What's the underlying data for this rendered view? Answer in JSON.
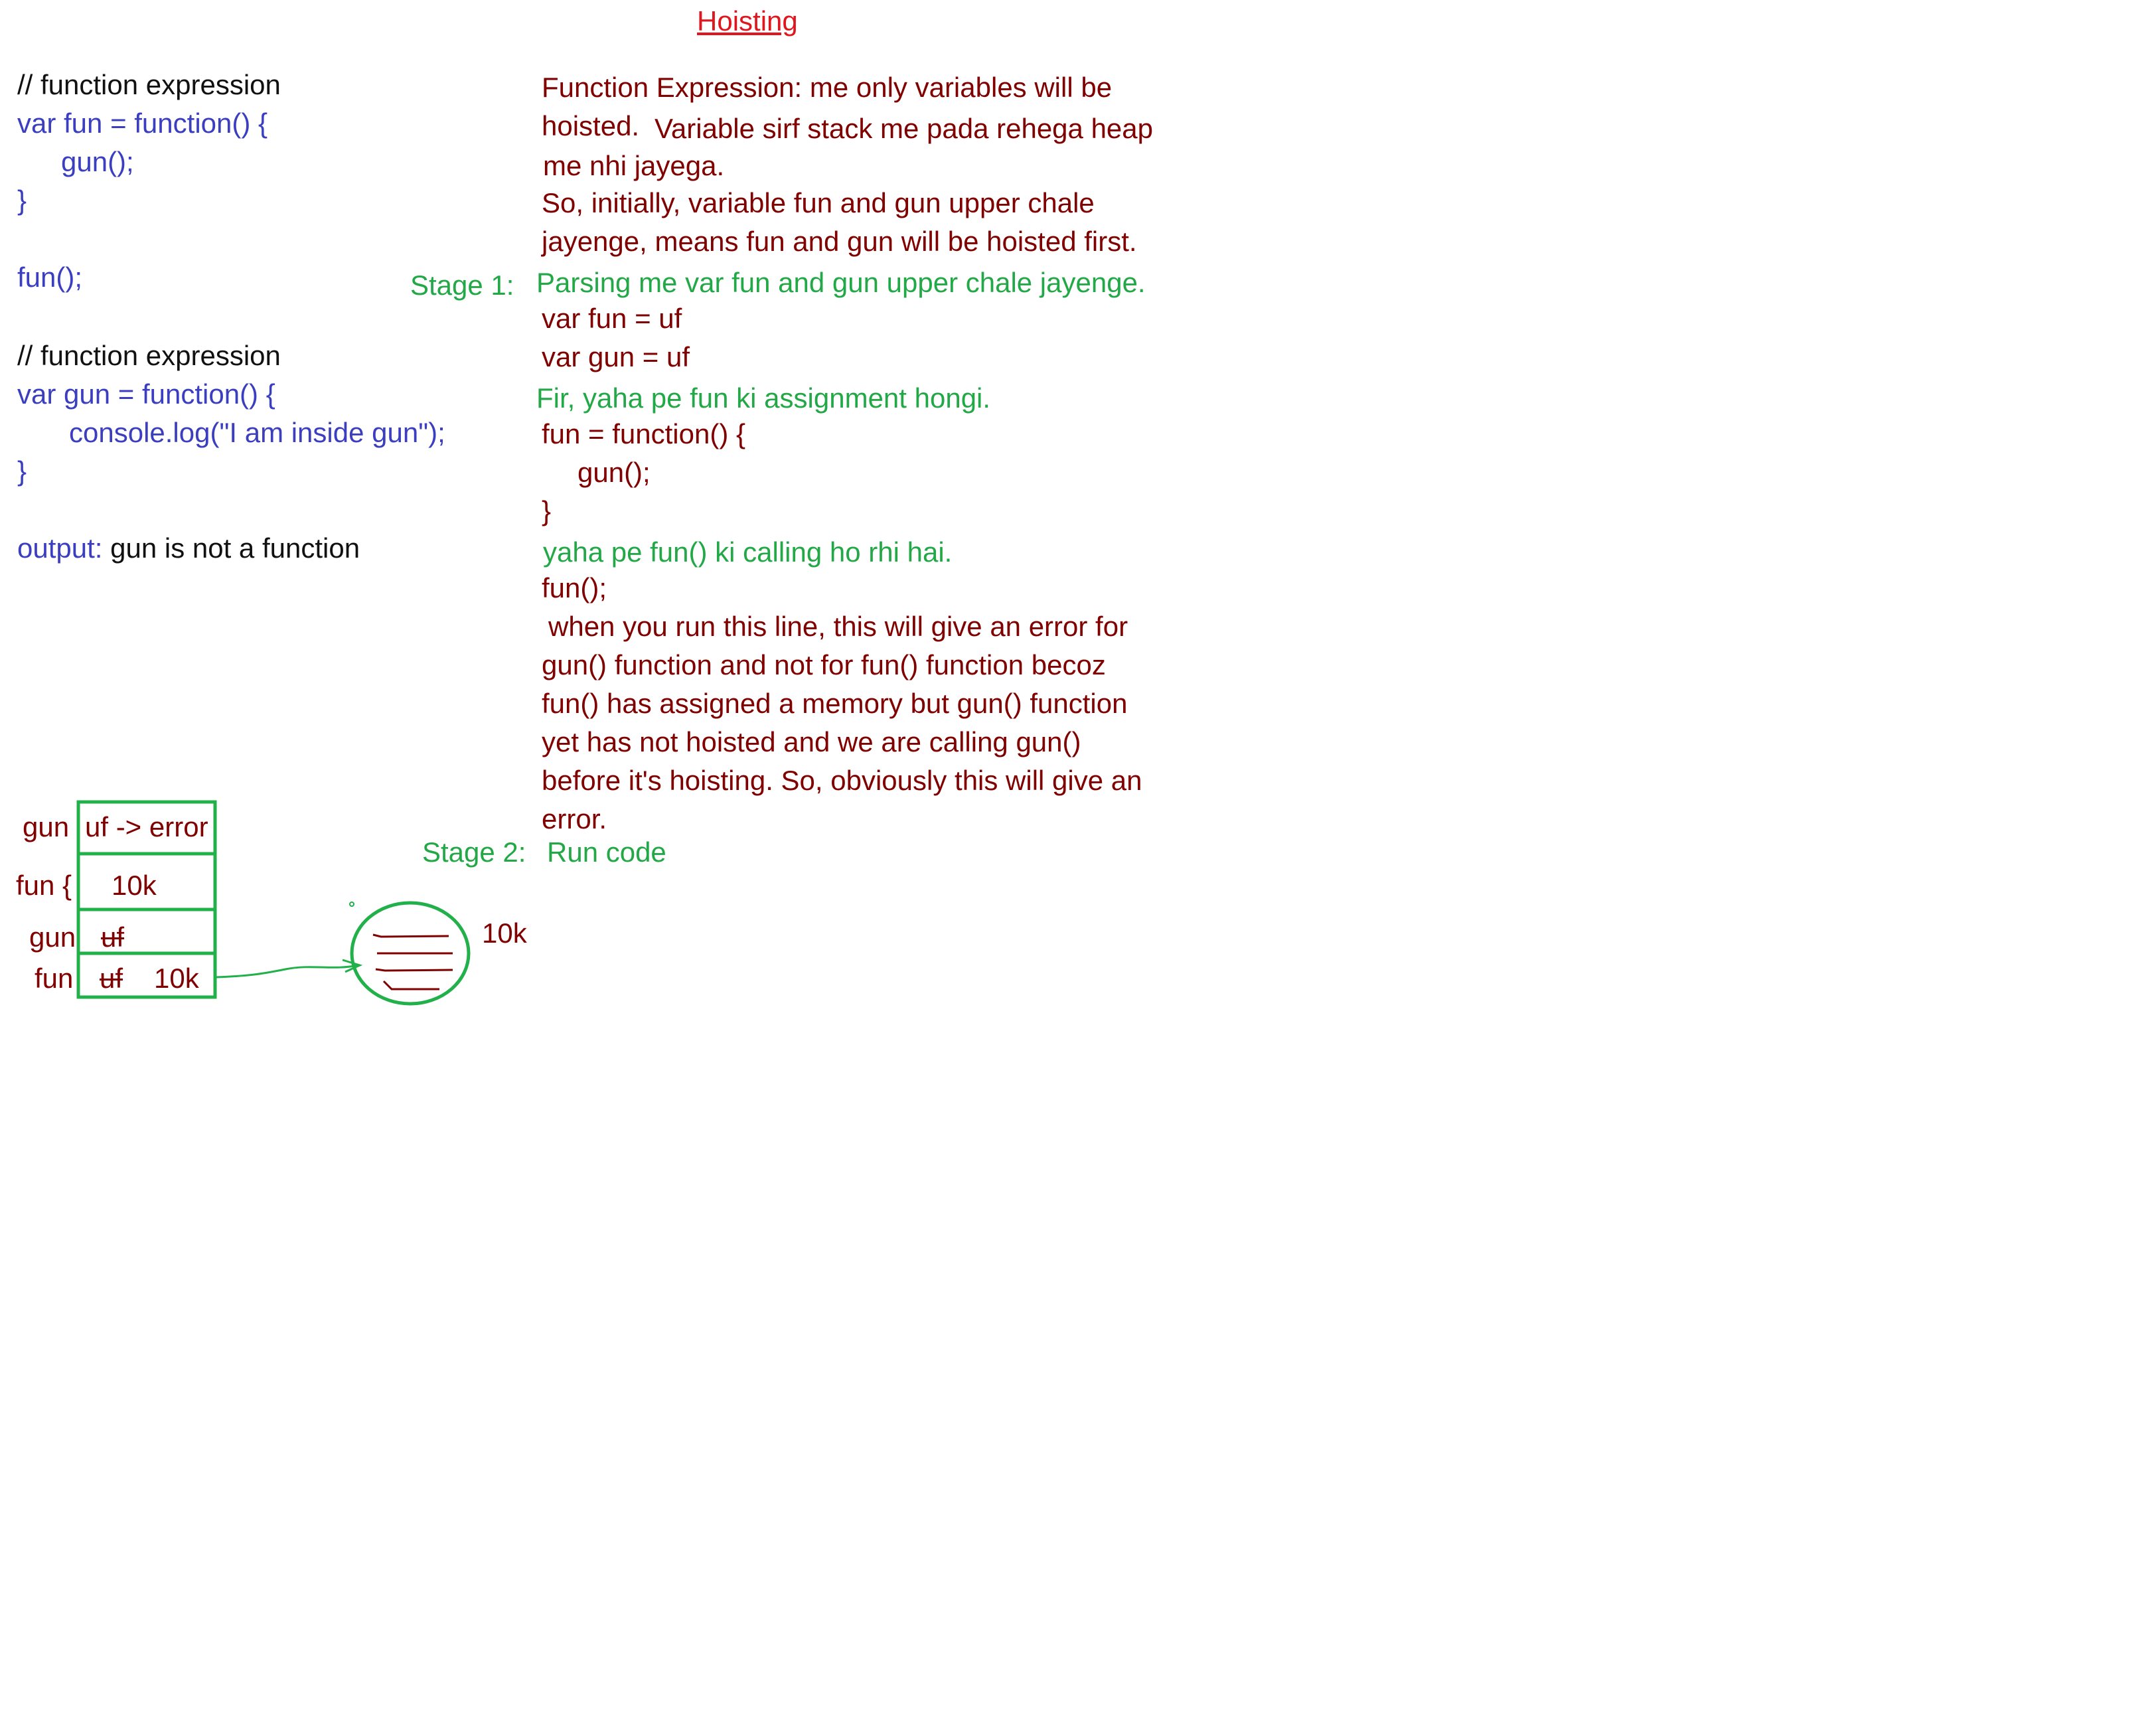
{
  "title": "Hoisting",
  "left_code": {
    "comment1": "// function expression",
    "line1": "var fun = function() {",
    "line2": "gun();",
    "line3": "}",
    "line4": "fun();",
    "comment2": "// function expression",
    "line5": "var gun = function() {",
    "line6": "console.log(\"I am inside gun\");",
    "line7": "}",
    "output_label": "output:",
    "output_value": "gun is not a function"
  },
  "explanation": {
    "p1_line1": "Function Expression: me only variables will be",
    "p1_line2a": "hoisted.",
    "p1_line2b": "Variable sirf stack me pada rehega heap",
    "p1_line3": "me nhi jayega.",
    "p2_line1": "So, initially, variable fun and gun upper chale",
    "p2_line2": "jayenge, means fun and gun will be hoisted first.",
    "stage1_label": "Stage 1:",
    "stage1_text": "Parsing me var fun and gun upper chale jayenge.",
    "var_fun": "var fun = uf",
    "var_gun": "var gun = uf",
    "assign_note": "Fir, yaha pe fun ki assignment hongi.",
    "assign_line1": "fun = function() {",
    "assign_line2": "gun();",
    "assign_line3": "}",
    "call_note": "yaha pe fun() ki calling ho rhi hai.",
    "call_line": "fun();",
    "err_line1": "when you run this line, this will give an error for",
    "err_line2": "gun() function and not for fun() function becoz",
    "err_line3": "fun() has assigned a memory but gun() function",
    "err_line4": "yet has not hoisted and we are calling gun()",
    "err_line5": "before it's hoisting. So, obviously this will give an",
    "err_line6": "error.",
    "stage2_label": "Stage 2:",
    "stage2_text": "Run code"
  },
  "memory": {
    "row1_label": "gun",
    "row1_value": "uf -> error",
    "row2_label": "fun {",
    "row2_value": "10k",
    "row3_label": "gun",
    "row3_value": "uf",
    "row4_label": "fun",
    "row4_value_struck": "uf",
    "row4_value": "10k",
    "heap_address": "10k"
  },
  "colors": {
    "title": "#e0161e",
    "code": "#3b3fbf",
    "note": "#800000",
    "stage": "#22a846",
    "comment": "#111111"
  }
}
